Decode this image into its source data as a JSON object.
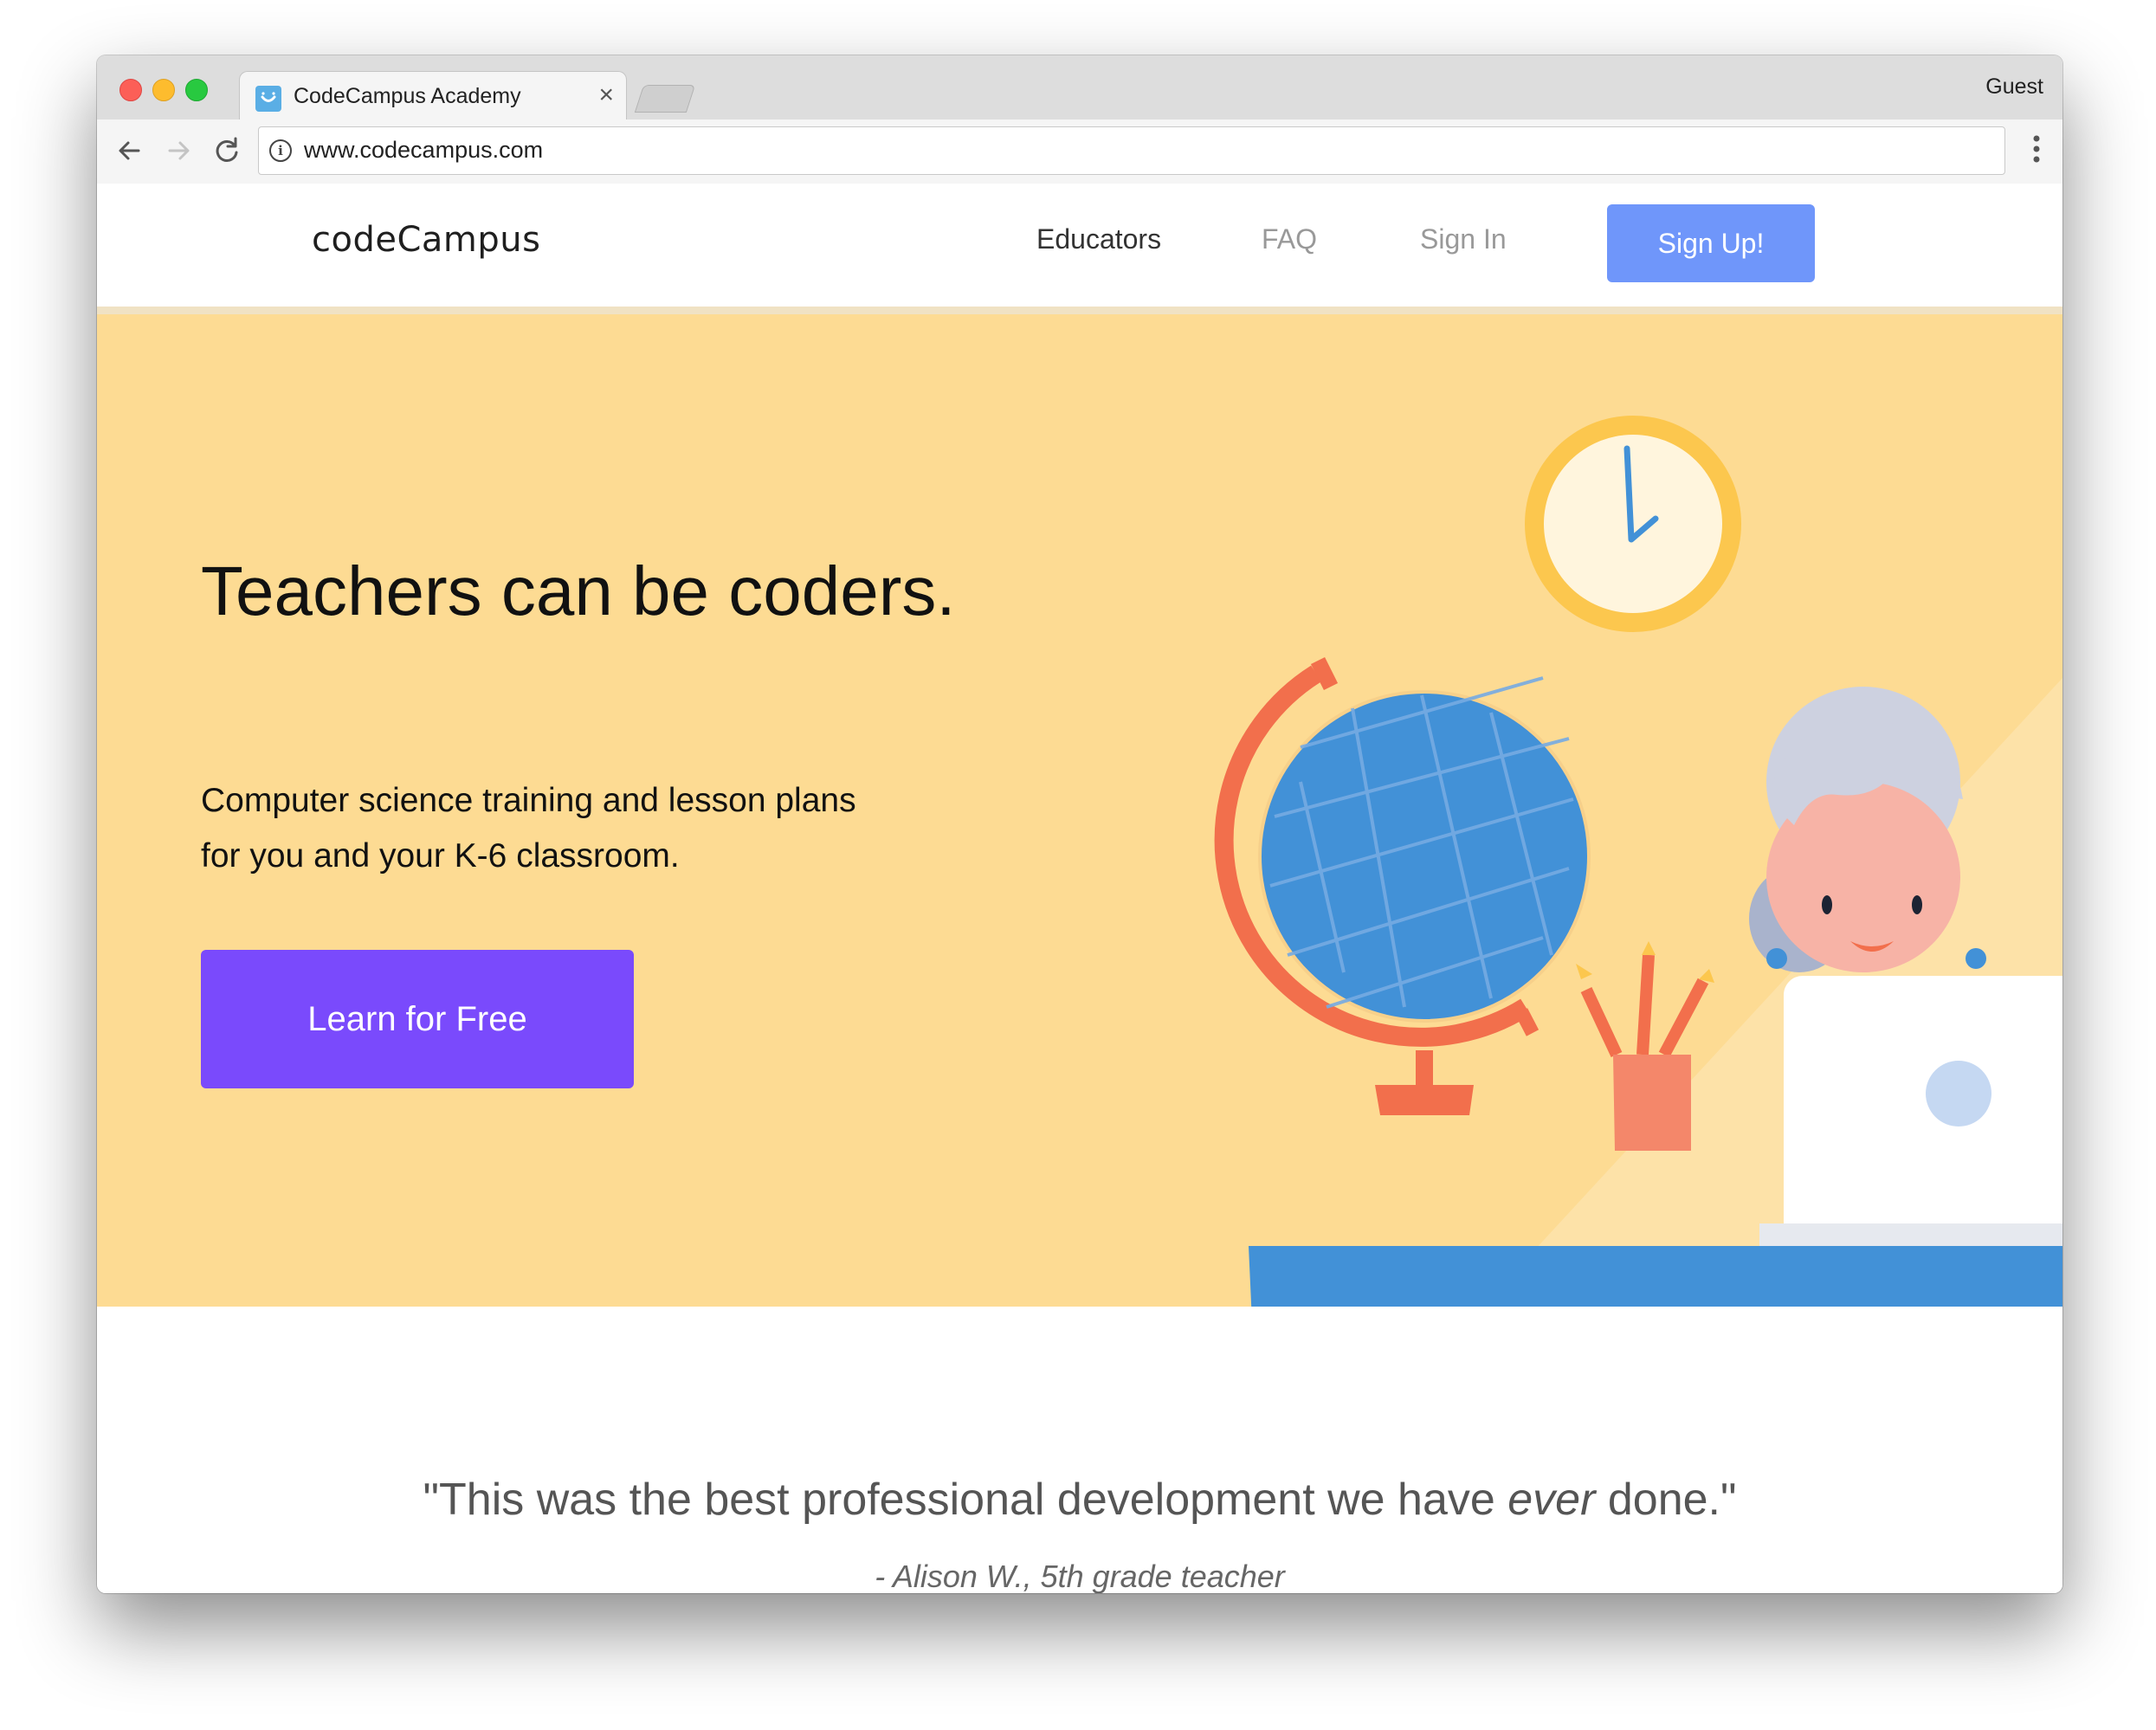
{
  "browser": {
    "tab_title": "CodeCampus Academy",
    "tab_close": "×",
    "profile": "Guest",
    "url": "www.codecampus.com",
    "icons": [
      "back-icon",
      "forward-icon",
      "reload-icon",
      "info-icon",
      "menu-icon",
      "close-icon"
    ]
  },
  "site": {
    "logo": "codeCampus",
    "nav": {
      "educators": "Educators",
      "faq": "FAQ",
      "signin": "Sign In",
      "signup": "Sign Up!"
    },
    "hero": {
      "title": "Teachers can be coders.",
      "subtitle": "Computer science training and lesson plans for you and your K-6 classroom.",
      "cta": "Learn for Free"
    },
    "testimonial": {
      "quote_before": "\"This was the best professional development we have ",
      "quote_emphasis": "ever",
      "quote_after": " done.\"",
      "attribution": "- Alison W., 5th grade teacher"
    }
  },
  "colors": {
    "hero_bg": "#fddb93",
    "signup_bg": "#6f96fa",
    "cta_bg": "#7a4afc",
    "globe": "#4291d7",
    "desk": "#4291d7"
  }
}
